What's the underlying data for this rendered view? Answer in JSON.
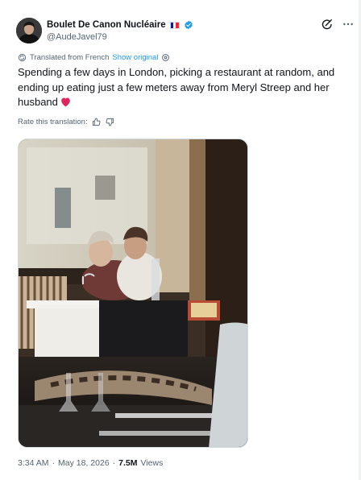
{
  "author": {
    "display_name": "Boulet De Canon Nucléaire",
    "handle": "@AudeJavel79",
    "flag_colors": [
      "#002395",
      "#ffffff",
      "#ed2939"
    ],
    "verified_color": "#1d9bf0"
  },
  "translation": {
    "label": "Translated from French",
    "show_original": "Show original",
    "rate_label": "Rate this translation:"
  },
  "tweet": {
    "text": "Spending a few days in London, picking a restaurant at random, and ending up eating just a few meters away from Meryl Streep and her husband",
    "heart_color": "#e0245e"
  },
  "meta": {
    "time": "3:34 AM",
    "separator": "·",
    "date": "May 18, 2026",
    "views_count": "7.5M",
    "views_label": "Views"
  },
  "icons": {
    "verified": "verified-badge-icon",
    "grok": "grok-icon",
    "more": "more-icon",
    "translate": "translate-icon",
    "settings": "gear-icon",
    "thumbs_up": "thumbs-up-icon",
    "thumbs_down": "thumbs-down-icon"
  }
}
